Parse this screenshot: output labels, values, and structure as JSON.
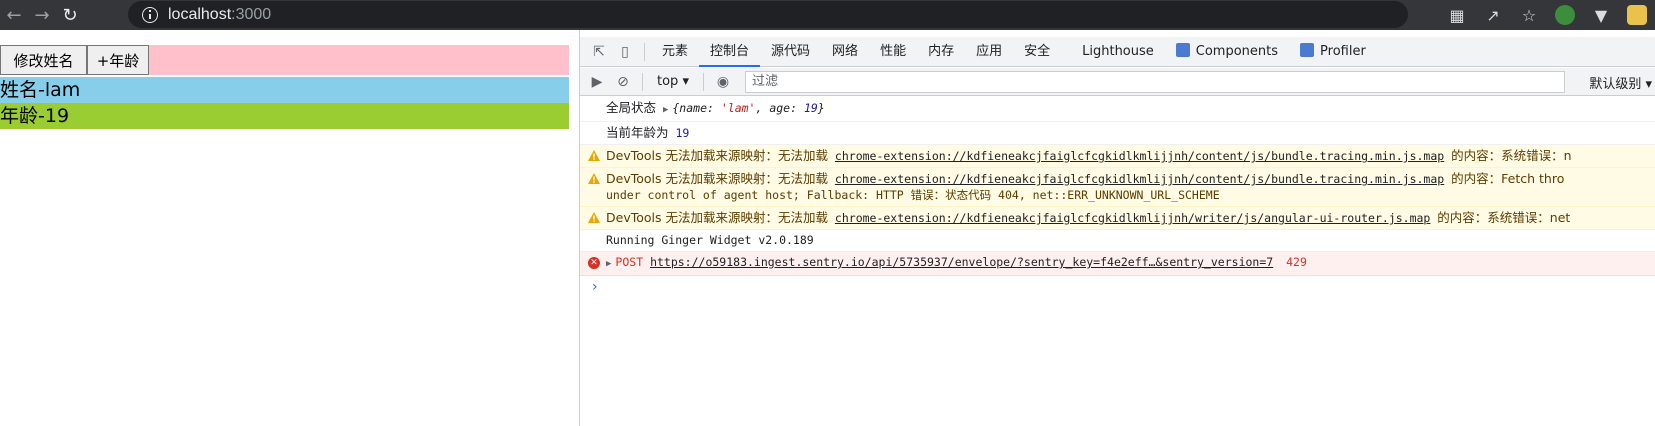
{
  "browser": {
    "url_host": "localhost",
    "url_port": ":3000"
  },
  "page": {
    "btn_change_name": "修改姓名",
    "btn_add_age": "+年龄",
    "name_text": "姓名-lam",
    "age_text": "年龄-19"
  },
  "devtools": {
    "tabs": [
      {
        "label": "元素"
      },
      {
        "label": "控制台"
      },
      {
        "label": "源代码"
      },
      {
        "label": "网络"
      },
      {
        "label": "性能"
      },
      {
        "label": "内存"
      },
      {
        "label": "应用"
      },
      {
        "label": "安全"
      },
      {
        "label": "Lighthouse"
      },
      {
        "label": "Components"
      },
      {
        "label": "Profiler"
      }
    ],
    "active_tab": "控制台",
    "context": "top",
    "filter_placeholder": "过滤",
    "levels": "默认级别",
    "console": {
      "line1_label": "全局状态",
      "line1_obj_open": "{name: ",
      "line1_name": "'lam'",
      "line1_mid": ", age: ",
      "line1_age": "19",
      "line1_close": "}",
      "line2_label": "当前年龄为",
      "line2_value": "19",
      "warn1_prefix": "DevTools 无法加载来源映射：无法加载",
      "warn1_link": "chrome-extension://kdfieneakcjfaiglcfcgkidlkmlijjnh/content/js/bundle.tracing.min.js.map",
      "warn1_suffix": "的内容：系统错误：n",
      "warn2_prefix": "DevTools 无法加载来源映射：无法加载",
      "warn2_link": "chrome-extension://kdfieneakcjfaiglcfcgkidlkmlijjnh/content/js/bundle.tracing.min.js.map",
      "warn2_suffix": "的内容：Fetch thro",
      "warn2_line2": "under control of agent host; Fallback: HTTP 错误：状态代码 404, net::ERR_UNKNOWN_URL_SCHEME",
      "warn3_prefix": "DevTools 无法加载来源映射：无法加载",
      "warn3_link": "chrome-extension://kdfieneakcjfaiglcfcgkidlkmlijjnh/writer/js/angular-ui-router.js.map",
      "warn3_suffix": "的内容：系统错误：net",
      "info_line": "Running Ginger Widget v2.0.189",
      "err_method": "POST",
      "err_link": "https://o59183.ingest.sentry.io/api/5735937/envelope/?sentry_key=f4e2eff…&sentry_version=7",
      "err_status": "429"
    }
  },
  "colors": {
    "buttons_row_bg": "#ffc0cb",
    "name_row_bg": "#87ceeb",
    "age_row_bg": "#9acd32",
    "accent": "#1a73e8"
  }
}
